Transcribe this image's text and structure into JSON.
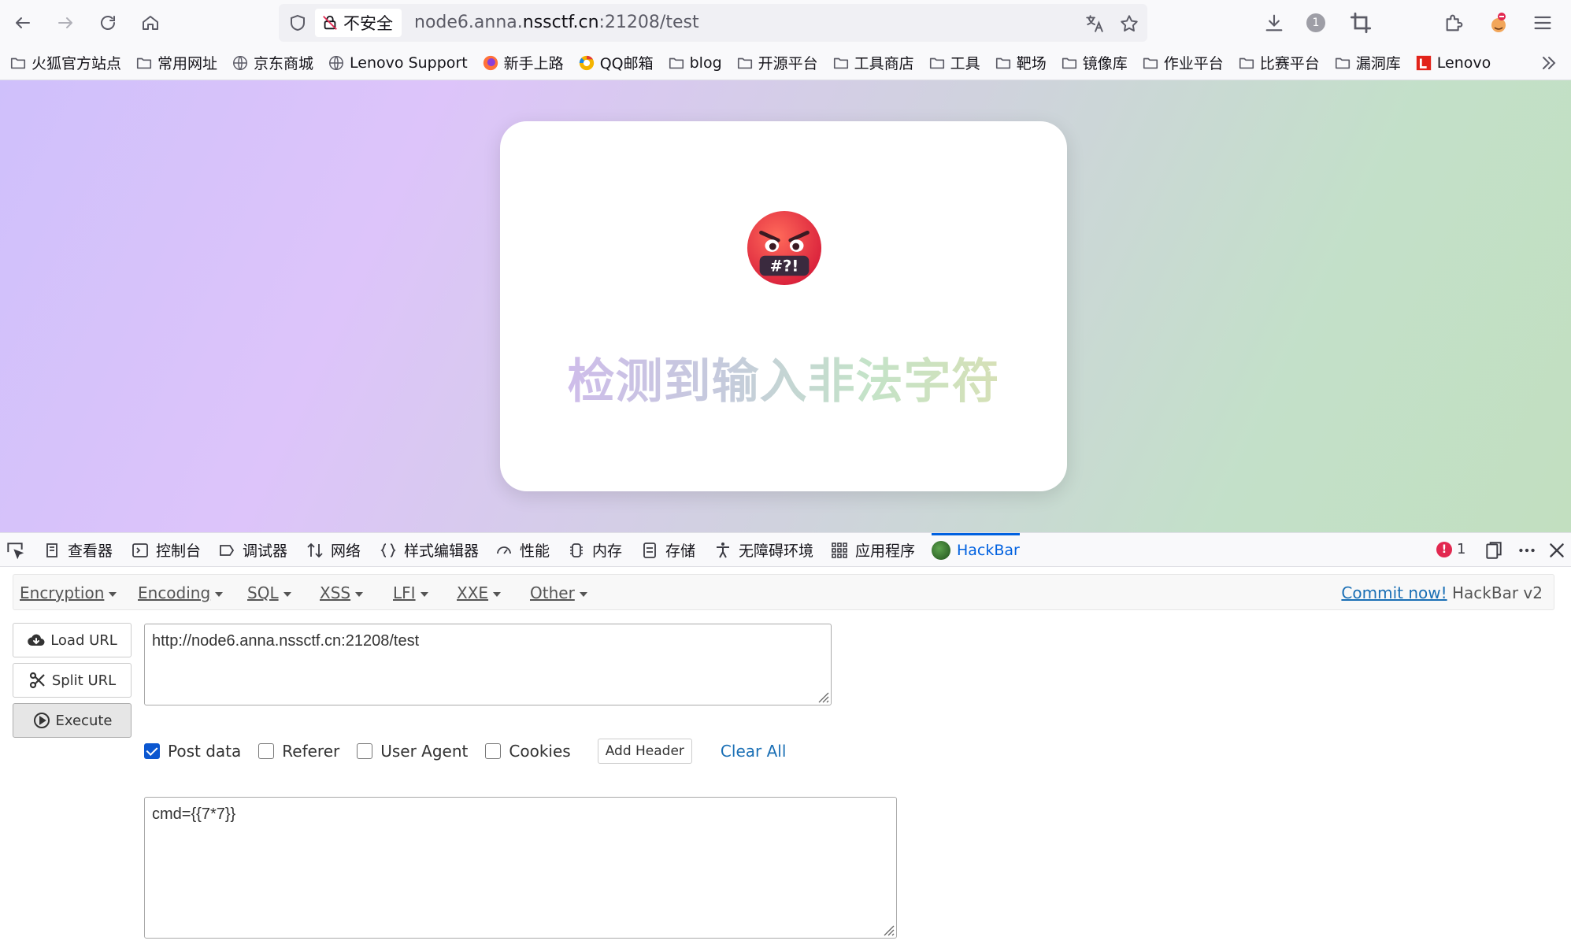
{
  "browser": {
    "security_label": "不安全",
    "url_host_prefix": "node6.anna.",
    "url_host_domain": "nssctf.cn",
    "url_rest": ":21208/test",
    "extension_badge": "1"
  },
  "bookmarks": [
    {
      "label": "火狐官方站点",
      "icon": "folder-icon"
    },
    {
      "label": "常用网址",
      "icon": "folder-icon"
    },
    {
      "label": "京东商城",
      "icon": "globe-icon"
    },
    {
      "label": "Lenovo Support",
      "icon": "globe-icon"
    },
    {
      "label": "新手上路",
      "icon": "firefox-icon"
    },
    {
      "label": "QQ邮箱",
      "icon": "qq-mail-icon"
    },
    {
      "label": "blog",
      "icon": "folder-icon"
    },
    {
      "label": "开源平台",
      "icon": "folder-icon"
    },
    {
      "label": "工具商店",
      "icon": "folder-icon"
    },
    {
      "label": "工具",
      "icon": "folder-icon"
    },
    {
      "label": "靶场",
      "icon": "folder-icon"
    },
    {
      "label": "镜像库",
      "icon": "folder-icon"
    },
    {
      "label": "作业平台",
      "icon": "folder-icon"
    },
    {
      "label": "比赛平台",
      "icon": "folder-icon"
    },
    {
      "label": "漏洞库",
      "icon": "folder-icon"
    },
    {
      "label": "Lenovo",
      "icon": "lenovo-icon"
    }
  ],
  "page": {
    "message": "检测到输入非法字符",
    "emoji": "angry-face-with-symbols-icon",
    "emoji_symbols": "#?!"
  },
  "devtools": {
    "tabs": [
      {
        "label": "查看器",
        "icon": "inspector-icon"
      },
      {
        "label": "控制台",
        "icon": "console-icon"
      },
      {
        "label": "调试器",
        "icon": "debugger-icon"
      },
      {
        "label": "网络",
        "icon": "network-icon"
      },
      {
        "label": "样式编辑器",
        "icon": "style-editor-icon"
      },
      {
        "label": "性能",
        "icon": "performance-icon"
      },
      {
        "label": "内存",
        "icon": "memory-icon"
      },
      {
        "label": "存储",
        "icon": "storage-icon"
      },
      {
        "label": "无障碍环境",
        "icon": "accessibility-icon"
      },
      {
        "label": "应用程序",
        "icon": "application-icon"
      },
      {
        "label": "HackBar",
        "icon": "hackbar-icon",
        "active": true
      }
    ],
    "error_count": "1",
    "active_color": "#0061e0"
  },
  "hackbar": {
    "menu": [
      "Encryption",
      "Encoding",
      "SQL",
      "XSS",
      "LFI",
      "XXE",
      "Other"
    ],
    "commit_link": "Commit now!",
    "version": "HackBar v2",
    "buttons": {
      "load_url": "Load URL",
      "split_url": "Split URL",
      "execute": "Execute"
    },
    "url_value": "http://node6.anna.nssctf.cn:21208/test",
    "options": {
      "post_data": "Post data",
      "referer": "Referer",
      "user_agent": "User Agent",
      "cookies": "Cookies",
      "add_header": "Add Header",
      "clear_all": "Clear All"
    },
    "post_checked": true,
    "post_body": "cmd={{7*7}}",
    "link_color": "#1a6fb5"
  }
}
